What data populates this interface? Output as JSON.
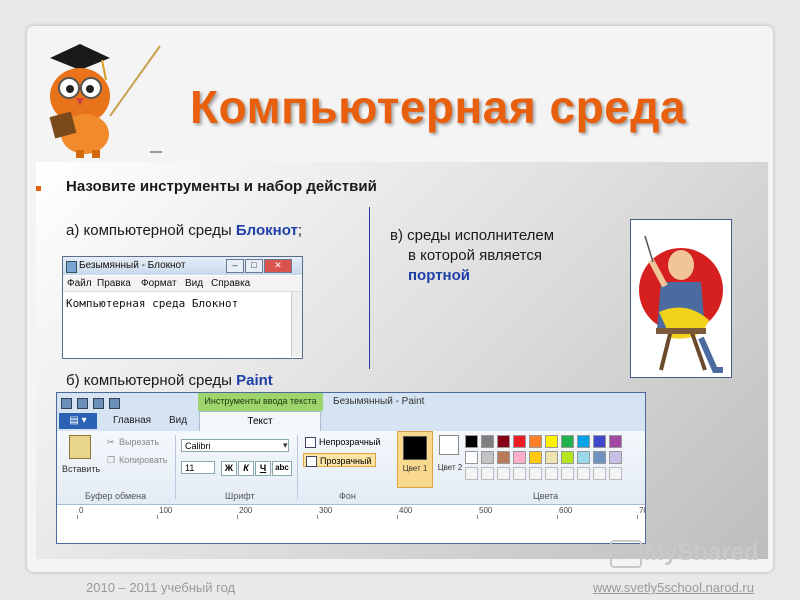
{
  "title": "Компьютерная среда",
  "heading": "Назовите инструменты и набор действий",
  "item_a": {
    "prefix": "а) компьютерной среды ",
    "highlight": "Блокнот",
    "suffix": ";"
  },
  "item_b": {
    "prefix": "б) компьютерной среды ",
    "highlight": "Paint"
  },
  "item_v": {
    "line1": "в) среды исполнителем",
    "line2": "в которой является",
    "highlight": "портной"
  },
  "notepad": {
    "title": "Безымянный - Блокнот",
    "menu": [
      "Файл",
      "Правка",
      "Формат",
      "Вид",
      "Справка"
    ],
    "text": "Компьютерная среда Блокнот"
  },
  "paint": {
    "context_tab": "Инструменты ввода текста",
    "window_title": "Безымянный - Paint",
    "tabs": [
      "Главная",
      "Вид"
    ],
    "active_tab": "Текст",
    "paste": "Вставить",
    "cut": "Вырезать",
    "copy": "Копировать",
    "clipboard_group": "Буфер обмена",
    "font_name": "Calibri",
    "font_size": "11",
    "bold": "Ж",
    "italic": "К",
    "underline": "Ч",
    "strike": "abc",
    "font_group": "Шрифт",
    "opaque": "Непрозрачный",
    "transparent": "Прозрачный",
    "bg_group": "Фон",
    "color1": "Цвет 1",
    "color2": "Цвет 2",
    "colors_group": "Цвета",
    "ruler": [
      "0",
      "100",
      "200",
      "300",
      "400",
      "500",
      "600",
      "70"
    ],
    "palette_row1": [
      "#000000",
      "#7f7f7f",
      "#880015",
      "#ed1c24",
      "#ff7f27",
      "#fff200",
      "#22b14c",
      "#00a2e8",
      "#3f48cc",
      "#a349a4"
    ],
    "palette_row2": [
      "#ffffff",
      "#c3c3c3",
      "#b97a57",
      "#ffaec9",
      "#ffc90e",
      "#efe4b0",
      "#b5e61d",
      "#99d9ea",
      "#7092be",
      "#c8bfe7"
    ]
  },
  "logo": "MyShared",
  "footer": {
    "year": "2010 – 2011 учебный год",
    "site": "www.svetly5school.narod.ru"
  },
  "colors": {
    "title": "#e8600d",
    "highlight": "#1f3fa8"
  }
}
